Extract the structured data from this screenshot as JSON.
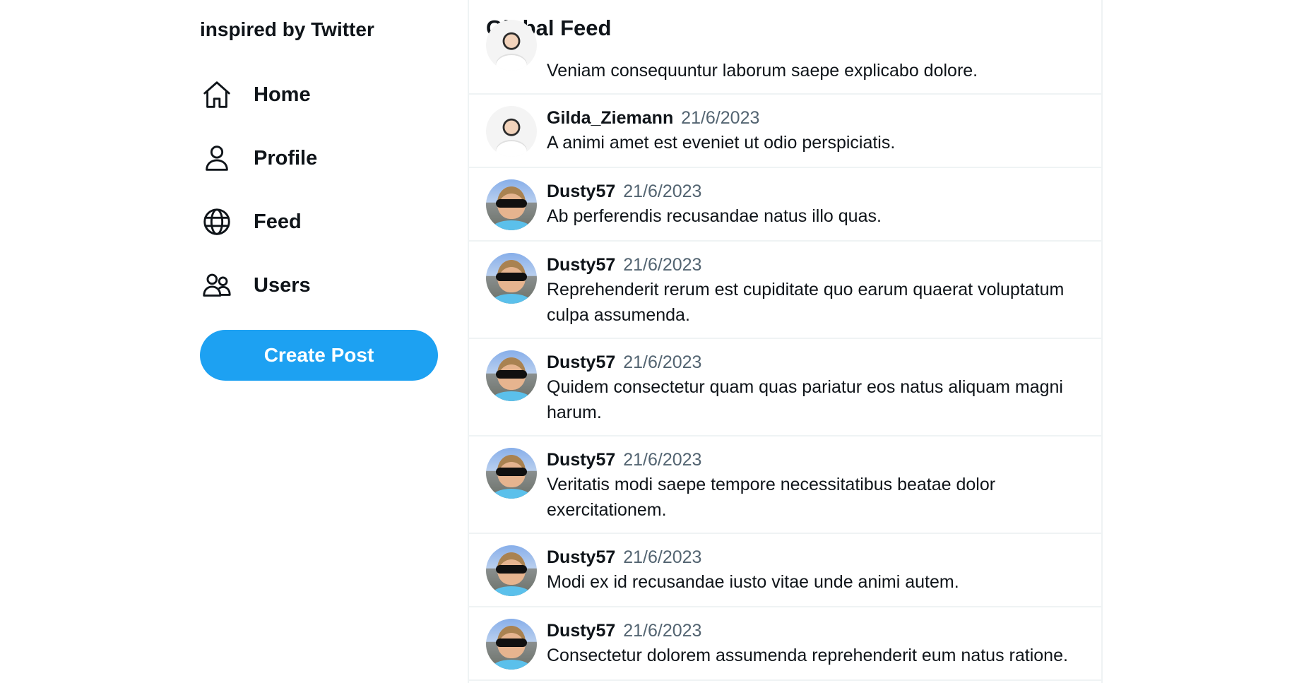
{
  "sidebar": {
    "brand": "inspired by Twitter",
    "nav": [
      {
        "label": "Home",
        "icon": "home-icon"
      },
      {
        "label": "Profile",
        "icon": "user-icon"
      },
      {
        "label": "Feed",
        "icon": "globe-icon"
      },
      {
        "label": "Users",
        "icon": "users-icon"
      }
    ],
    "create_post": "Create Post",
    "accent_color": "#1da1f2"
  },
  "feed": {
    "title": "Global Feed",
    "posts": [
      {
        "username": "",
        "date": "",
        "text": "Veniam consequuntur laborum saepe explicabo dolore."
      },
      {
        "username": "Gilda_Ziemann",
        "date": "21/6/2023",
        "text": "A animi amet est eveniet ut odio perspiciatis."
      },
      {
        "username": "Dusty57",
        "date": "21/6/2023",
        "text": "Ab perferendis recusandae natus illo quas."
      },
      {
        "username": "Dusty57",
        "date": "21/6/2023",
        "text": "Reprehenderit rerum est cupiditate quo earum quaerat voluptatum culpa assumenda."
      },
      {
        "username": "Dusty57",
        "date": "21/6/2023",
        "text": "Quidem consectetur quam quas pariatur eos natus aliquam magni harum."
      },
      {
        "username": "Dusty57",
        "date": "21/6/2023",
        "text": "Veritatis modi saepe tempore necessitatibus beatae dolor exercitationem."
      },
      {
        "username": "Dusty57",
        "date": "21/6/2023",
        "text": "Modi ex id recusandae iusto vitae unde animi autem."
      },
      {
        "username": "Dusty57",
        "date": "21/6/2023",
        "text": "Consectetur dolorem assumenda reprehenderit eum natus ratione."
      }
    ]
  }
}
